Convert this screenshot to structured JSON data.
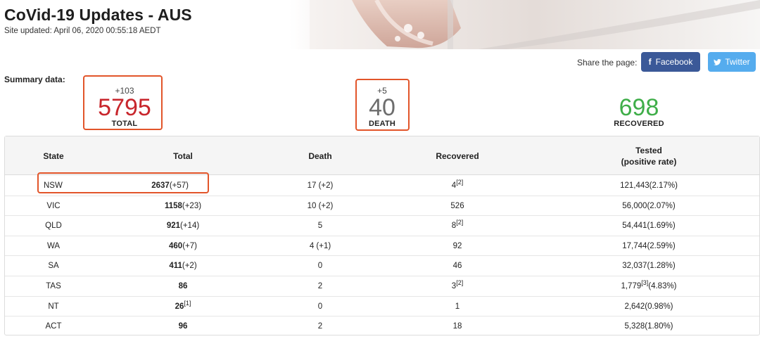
{
  "header": {
    "title": "CoVid-19 Updates - AUS",
    "updated": "Site updated: April 06, 2020 00:55:18 AEDT"
  },
  "share": {
    "label": "Share the page:",
    "facebook": "Facebook",
    "twitter": "Twitter"
  },
  "summary": {
    "label": "Summary data:",
    "total": {
      "delta": "+103",
      "value": "5795",
      "caption": "TOTAL"
    },
    "death": {
      "delta": "+5",
      "value": "40",
      "caption": "DEATH"
    },
    "recovered": {
      "value": "698",
      "caption": "RECOVERED"
    }
  },
  "colors": {
    "total": "#c8262c",
    "death": "#6d6d6d",
    "recovered": "#3fae49",
    "highlight": "#e2552a",
    "facebook": "#3b5998",
    "twitter": "#55acee"
  },
  "table": {
    "headers": {
      "state": "State",
      "total": "Total",
      "death": "Death",
      "recovered": "Recovered",
      "tested_line1": "Tested",
      "tested_line2": "(positive rate)"
    },
    "rows": [
      {
        "state": "NSW",
        "total": "2637",
        "total_delta": "(+57)",
        "total_note": "",
        "death": "17 (+2)",
        "recovered": "4",
        "recovered_note": "[2]",
        "tested": "121,443",
        "tested_note": "",
        "rate": "(2.17%)"
      },
      {
        "state": "VIC",
        "total": "1158",
        "total_delta": "(+23)",
        "total_note": "",
        "death": "10 (+2)",
        "recovered": "526",
        "recovered_note": "",
        "tested": "56,000",
        "tested_note": "",
        "rate": "(2.07%)"
      },
      {
        "state": "QLD",
        "total": "921",
        "total_delta": "(+14)",
        "total_note": "",
        "death": "5",
        "recovered": "8",
        "recovered_note": "[2]",
        "tested": "54,441",
        "tested_note": "",
        "rate": "(1.69%)"
      },
      {
        "state": "WA",
        "total": "460",
        "total_delta": "(+7)",
        "total_note": "",
        "death": "4 (+1)",
        "recovered": "92",
        "recovered_note": "",
        "tested": "17,744",
        "tested_note": "",
        "rate": "(2.59%)"
      },
      {
        "state": "SA",
        "total": "411",
        "total_delta": "(+2)",
        "total_note": "",
        "death": "0",
        "recovered": "46",
        "recovered_note": "",
        "tested": "32,037",
        "tested_note": "",
        "rate": "(1.28%)"
      },
      {
        "state": "TAS",
        "total": "86",
        "total_delta": "",
        "total_note": "",
        "death": "2",
        "recovered": "3",
        "recovered_note": "[2]",
        "tested": "1,779",
        "tested_note": "[3]",
        "rate": "(4.83%)"
      },
      {
        "state": "NT",
        "total": "26",
        "total_delta": "",
        "total_note": "[1]",
        "death": "0",
        "recovered": "1",
        "recovered_note": "",
        "tested": "2,642",
        "tested_note": "",
        "rate": "(0.98%)"
      },
      {
        "state": "ACT",
        "total": "96",
        "total_delta": "",
        "total_note": "",
        "death": "2",
        "recovered": "18",
        "recovered_note": "",
        "tested": "5,328",
        "tested_note": "",
        "rate": "(1.80%)"
      }
    ]
  }
}
